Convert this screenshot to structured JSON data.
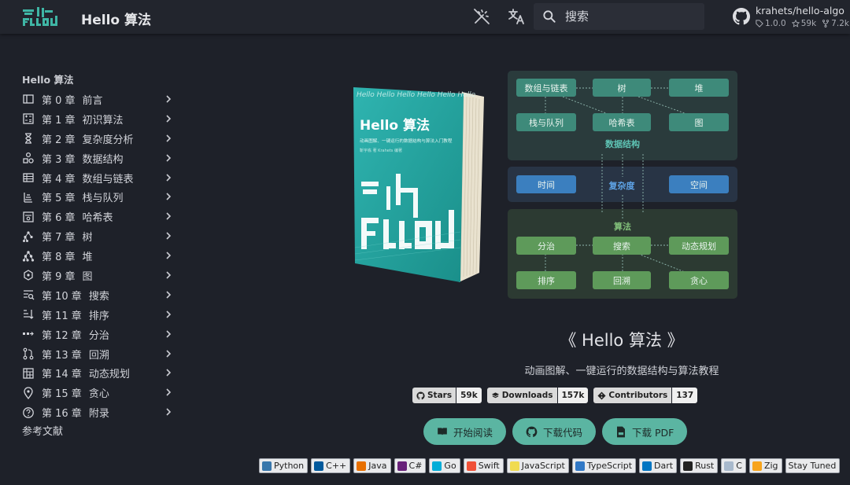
{
  "header": {
    "site_title": "Hello 算法",
    "search_placeholder": "搜索",
    "repo_name": "krahets/hello-algo",
    "repo_version": "1.0.0",
    "repo_stars": "59k",
    "repo_forks": "7.2k"
  },
  "sidebar": {
    "title": "Hello 算法",
    "items": [
      {
        "chapter": "第 0 章",
        "label": "前言",
        "icon": "book-open-icon"
      },
      {
        "chapter": "第 1 章",
        "label": "初识算法",
        "icon": "calculator-icon"
      },
      {
        "chapter": "第 2 章",
        "label": "复杂度分析",
        "icon": "hourglass-icon"
      },
      {
        "chapter": "第 3 章",
        "label": "数据结构",
        "icon": "shapes-icon"
      },
      {
        "chapter": "第 4 章",
        "label": "数组与链表",
        "icon": "table-icon"
      },
      {
        "chapter": "第 5 章",
        "label": "栈与队列",
        "icon": "stack-icon"
      },
      {
        "chapter": "第 6 章",
        "label": "哈希表",
        "icon": "hash-search-icon"
      },
      {
        "chapter": "第 7 章",
        "label": "树",
        "icon": "tree-icon"
      },
      {
        "chapter": "第 8 章",
        "label": "堆",
        "icon": "heap-icon"
      },
      {
        "chapter": "第 9 章",
        "label": "图",
        "icon": "graph-icon"
      },
      {
        "chapter": "第 10 章",
        "label": "搜索",
        "icon": "text-search-icon"
      },
      {
        "chapter": "第 11 章",
        "label": "排序",
        "icon": "sort-icon"
      },
      {
        "chapter": "第 12 章",
        "label": "分治",
        "icon": "divide-icon"
      },
      {
        "chapter": "第 13 章",
        "label": "回溯",
        "icon": "backtrack-icon"
      },
      {
        "chapter": "第 14 章",
        "label": "动态规划",
        "icon": "grid-icon"
      },
      {
        "chapter": "第 15 章",
        "label": "贪心",
        "icon": "location-icon"
      },
      {
        "chapter": "第 16 章",
        "label": "附录",
        "icon": "help-circle-icon"
      }
    ],
    "references": "参考文献"
  },
  "book": {
    "title": "Hello 算法",
    "tagline": "动画图解、一键运行的数据结构与算法入门教程",
    "authors": "靳宇栋 著  Krahets 编著",
    "logo_text": "HELLO",
    "logo_chars": "算法"
  },
  "diagram": {
    "ds_boxes": [
      "数组与链表",
      "树",
      "堆",
      "栈与队列",
      "哈希表",
      "图"
    ],
    "ds_label": "数据结构",
    "cx_boxes": [
      "时间",
      "空间"
    ],
    "cx_label": "复杂度",
    "algo_label": "算法",
    "algo_boxes": [
      "分治",
      "搜索",
      "动态规划",
      "排序",
      "回溯",
      "贪心"
    ]
  },
  "hero": {
    "title": "《 Hello 算法 》",
    "subtitle": "动画图解、一键运行的数据结构与算法教程"
  },
  "badges": [
    {
      "label": "Stars",
      "value": "59k"
    },
    {
      "label": "Downloads",
      "value": "157k"
    },
    {
      "label": "Contributors",
      "value": "137"
    }
  ],
  "buttons": {
    "read": "开始阅读",
    "code": "下载代码",
    "pdf": "下载 PDF"
  },
  "languages": [
    {
      "name": "Python",
      "color": "#3776ab"
    },
    {
      "name": "C++",
      "color": "#00599c"
    },
    {
      "name": "Java",
      "color": "#e76f00"
    },
    {
      "name": "C#",
      "color": "#68217a"
    },
    {
      "name": "Go",
      "color": "#00add8"
    },
    {
      "name": "Swift",
      "color": "#f05138"
    },
    {
      "name": "JavaScript",
      "color": "#f0db4f"
    },
    {
      "name": "TypeScript",
      "color": "#3178c6"
    },
    {
      "name": "Dart",
      "color": "#0175c2"
    },
    {
      "name": "Rust",
      "color": "#222222"
    },
    {
      "name": "C",
      "color": "#a8b9cc"
    },
    {
      "name": "Zig",
      "color": "#f7a41d"
    },
    {
      "name": "Stay Tuned",
      "color": ""
    }
  ],
  "colors": {
    "accent": "#5bb5a2",
    "background": "#1e2129",
    "header": "#22252d"
  }
}
